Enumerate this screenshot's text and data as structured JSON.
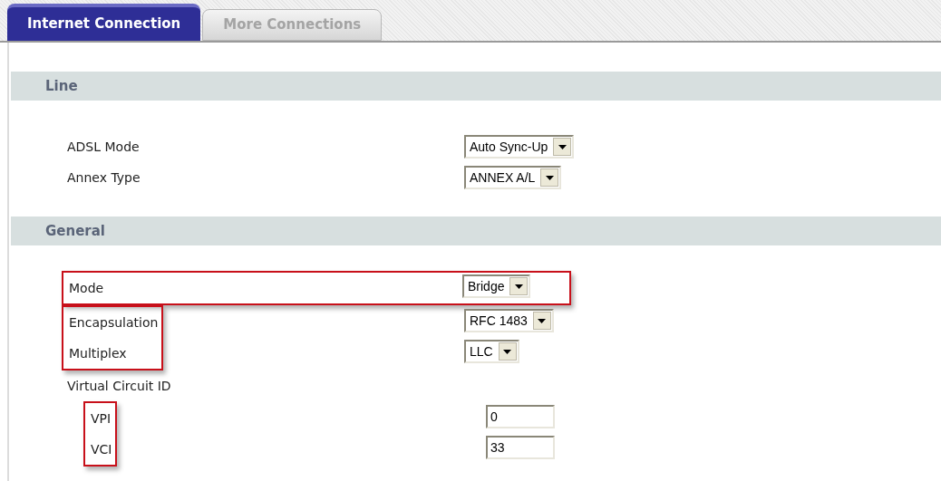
{
  "tabs": [
    {
      "label": "Internet Connection",
      "selected": true
    },
    {
      "label": "More Connections",
      "selected": false
    }
  ],
  "sections": [
    {
      "title": "Line",
      "groups": [
        {
          "kind": "plain",
          "rows": [
            {
              "label": "ADSL Mode",
              "kind": "select",
              "value": "Auto Sync-Up"
            },
            {
              "label": "Annex Type",
              "kind": "select",
              "value": "ANNEX A/L"
            }
          ]
        }
      ]
    },
    {
      "title": "General",
      "groups": [
        {
          "kind": "row",
          "rows": [
            {
              "label": "Mode",
              "kind": "select",
              "value": "Bridge"
            }
          ]
        },
        {
          "kind": "labels",
          "rows": [
            {
              "label": "Encapsulation",
              "kind": "select",
              "value": "RFC 1483"
            },
            {
              "label": "Multiplex",
              "kind": "select",
              "value": "LLC"
            }
          ]
        },
        {
          "kind": "plain",
          "rows": [
            {
              "label": "Virtual Circuit ID",
              "kind": "heading",
              "children": {
                "kind": "labels",
                "rows": [
                  {
                    "label": "VPI",
                    "kind": "text",
                    "value": "0"
                  },
                  {
                    "label": "VCI",
                    "kind": "text",
                    "value": "33"
                  }
                ]
              }
            }
          ]
        }
      ]
    }
  ]
}
